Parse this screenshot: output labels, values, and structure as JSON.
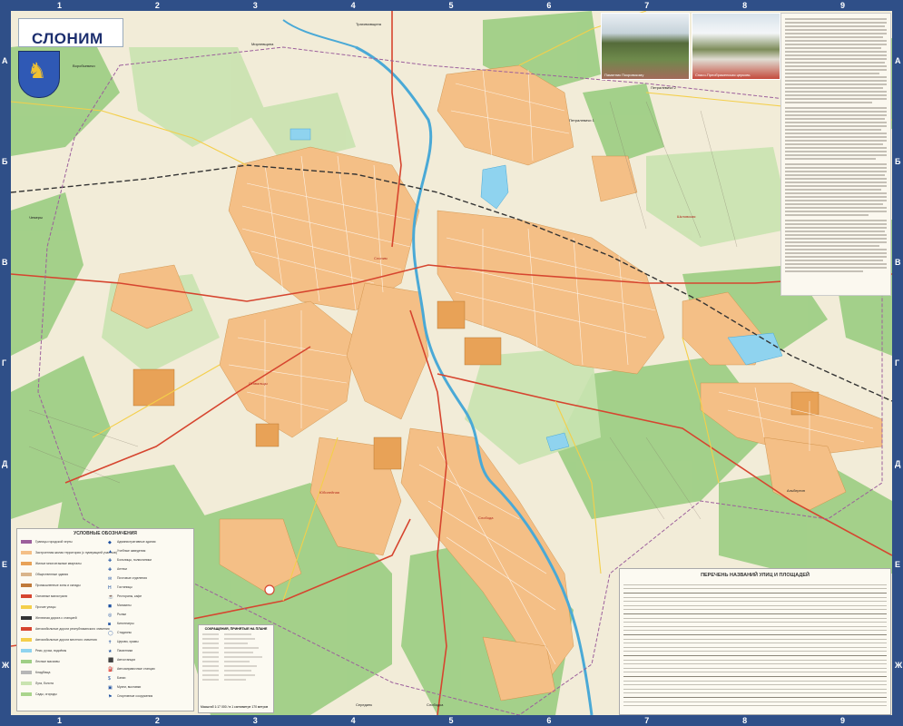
{
  "map": {
    "title": "СЛОНИМ",
    "grid": {
      "columns": [
        "1",
        "2",
        "3",
        "4",
        "5",
        "6",
        "7",
        "8",
        "9"
      ],
      "rows": [
        "А",
        "Б",
        "В",
        "Г",
        "Д",
        "Е",
        "Ж"
      ]
    },
    "photos": {
      "left_caption": "Памятник Покровскому",
      "right_caption": "Спасо-Преображенская церковь"
    },
    "place_labels": {
      "north": "Трахимовщина",
      "northwest": "Воробьевичи",
      "west": "Чемеры",
      "northeast_village": "Петралевичи 2",
      "north_village": "Петралевичи 1",
      "north_west_village": "Мирлевщина",
      "east": "Альбертин",
      "south": "Слободка",
      "southwest": "Серединк"
    },
    "district_labels": {
      "center": "Слоним",
      "west_district": "Ставальцы",
      "east_district": "Шкловская",
      "south_district": "Слобода",
      "southwest_district": "Юбилейная"
    },
    "legend": {
      "title": "УСЛОВНЫЕ ОБОЗНАЧЕНИЯ",
      "left_items": [
        "Границы городской черты",
        "Застроенная жилая территория (с нумерацией участков)",
        "Жилые многоэтажные кварталы",
        "Общественные здания",
        "Промышленные зоны и склады",
        "Основные магистрали",
        "Прочие улицы",
        "Железная дорога с станцией",
        "Автомобильные дороги республиканского значения",
        "Автомобильные дороги местного значения",
        "Реки, ручьи, водоёмы",
        "Лесные массивы",
        "Кладбища",
        "Луга, болота",
        "Сады, огороды"
      ],
      "right_items": [
        "Административные здания",
        "Учебные заведения",
        "Больницы, поликлиники",
        "Аптеки",
        "Почтовые отделения",
        "Гостиницы",
        "Рестораны, кафе",
        "Магазины",
        "Рынки",
        "Кинотеатры",
        "Стадионы",
        "Церкви, храмы",
        "Памятники",
        "Автостанции",
        "Автозаправочные станции",
        "Банки",
        "Музеи, выставки",
        "Спортивные сооружения"
      ]
    },
    "abbreviations": {
      "title": "СОКРАЩЕНИЯ, ПРИНЯТЫЕ НА ПЛАНЕ",
      "scale": "Масштаб 1:17 000 / в 1 сантиметре 170 метров"
    },
    "streets_index": {
      "title": "ПЕРЕЧЕНЬ НАЗВАНИЙ УЛИЦ И ПЛОЩАДЕЙ"
    }
  }
}
